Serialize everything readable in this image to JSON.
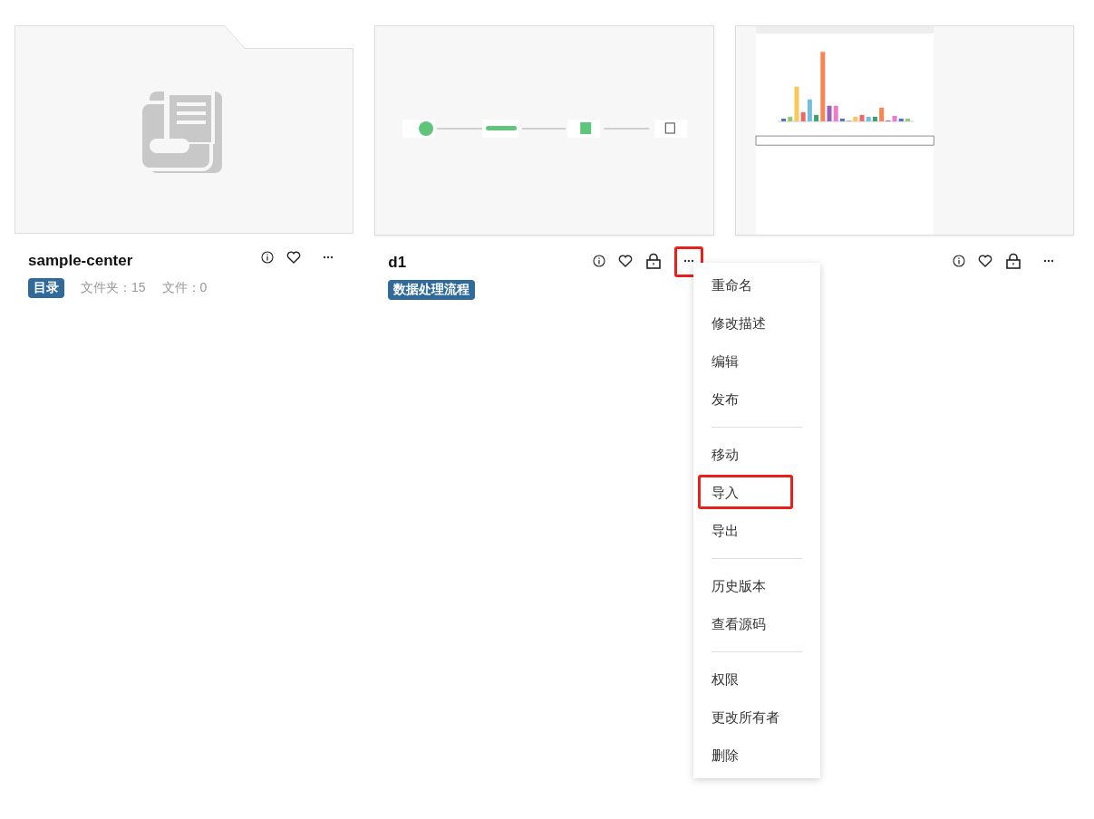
{
  "cards": [
    {
      "kind": "folder",
      "title": "sample-center",
      "tag": "目录",
      "stats": [
        "文件夹：15",
        "文件：0"
      ],
      "locked": false,
      "more_highlighted": false
    },
    {
      "kind": "flow",
      "title": "d1",
      "tag": "数据处理流程",
      "locked": true,
      "more_highlighted": true
    },
    {
      "kind": "chart",
      "locked": true,
      "more_highlighted": false
    }
  ],
  "menu": {
    "groups": [
      [
        {
          "label": "重命名",
          "highlighted": false
        },
        {
          "label": "修改描述",
          "highlighted": false
        },
        {
          "label": "编辑",
          "highlighted": false
        },
        {
          "label": "发布",
          "highlighted": false
        }
      ],
      [
        {
          "label": "移动",
          "highlighted": false
        },
        {
          "label": "导入",
          "highlighted": true
        },
        {
          "label": "导出",
          "highlighted": false
        }
      ],
      [
        {
          "label": "历史版本",
          "highlighted": false
        },
        {
          "label": "查看源码",
          "highlighted": false
        }
      ],
      [
        {
          "label": "权限",
          "highlighted": false
        },
        {
          "label": "更改所有者",
          "highlighted": false
        },
        {
          "label": "删除",
          "highlighted": false
        }
      ]
    ]
  }
}
